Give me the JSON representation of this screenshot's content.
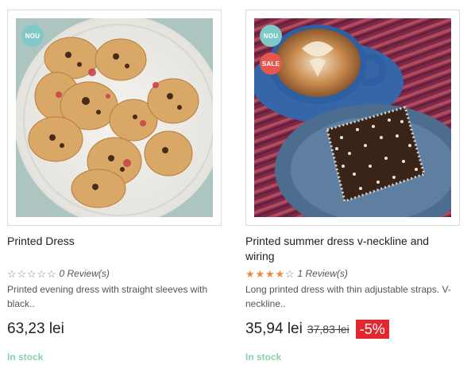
{
  "products": [
    {
      "badge_new": "NOU",
      "title": "Printed Dress",
      "rating": 0,
      "reviews": "0 Review(s)",
      "description": "Printed evening dress with straight sleeves with black..",
      "price": "63,23 lei",
      "stock": "In stock"
    },
    {
      "badge_new": "NOU",
      "badge_sale": "SALE",
      "title": "Printed summer dress v-neckline and wiring",
      "rating": 4,
      "reviews": "1 Review(s)",
      "description": "Long printed dress with thin adjustable straps. V-neckline..",
      "price": "35,94 lei",
      "old_price": "37,83 lei",
      "discount": "-5%",
      "stock": "In stock"
    }
  ],
  "colors": {
    "badge_new": "#7fc9c9",
    "badge_sale": "#e8574f",
    "star_on": "#f08a3a",
    "discount_bg": "#e2272e",
    "in_stock": "#8ccfa8"
  }
}
